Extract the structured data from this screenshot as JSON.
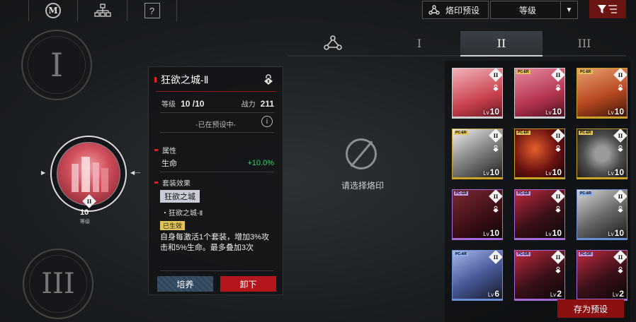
{
  "top_nav": {
    "help": "?"
  },
  "toolbar": {
    "preset_label": "烙印预设",
    "sort_value": "等级",
    "save_label": "存为预设"
  },
  "slots": {
    "slot1_numeral": "I",
    "slot3_numeral": "III",
    "selected_level": "10",
    "selected_level_label": "等级",
    "selected_rank": "II"
  },
  "detail": {
    "name": "狂欲之城-Ⅱ",
    "level_label": "等级",
    "level_value": "10 /10",
    "power_label": "战力",
    "power_value": "211",
    "preset_status": "-已在预设中-",
    "attr_header": "属性",
    "attr_name": "生命",
    "attr_value": "+10.0%",
    "set_header": "套装效果",
    "set_name": "狂欲之城",
    "set_piece": "・狂欲之城-Ⅱ",
    "active_tag": "已生效",
    "set_desc": "自身每激活1个套装，增加3%攻击和5%生命。最多叠加3次",
    "upgrade_label": "培养",
    "unequip_label": "卸下"
  },
  "tabs": [
    "I",
    "II",
    "III"
  ],
  "empty_prompt": "请选择烙印",
  "colors": {
    "accent_red": "#8b1111",
    "positive_green": "#3ecf6a",
    "gold_border": "#c9a227",
    "purple_border": "#a66bd6",
    "blue_border": "#6b8fd6"
  },
  "grid": [
    {
      "type": "",
      "rank": "II",
      "level": "10",
      "border": "#cfcfcf",
      "art": "pink-city",
      "locked": true
    },
    {
      "type": "PC-ER",
      "rank": "II",
      "level": "10",
      "border": "#cfcfcf",
      "art": "pink",
      "locked": true
    },
    {
      "type": "PC-ER",
      "rank": "II",
      "level": "10",
      "border": "#c9a227",
      "art": "orange",
      "locked": true
    },
    {
      "type": "PC-ER",
      "rank": "II",
      "level": "10",
      "border": "#c9a227",
      "art": "silver",
      "locked": true
    },
    {
      "type": "PC-ER",
      "rank": "II",
      "level": "10",
      "border": "#c9a227",
      "art": "dark-red",
      "locked": true
    },
    {
      "type": "PC-ER",
      "rank": "II",
      "level": "10",
      "border": "#c9a227",
      "art": "emblem",
      "locked": true
    },
    {
      "type": "PC-GR",
      "rank": "II",
      "level": "10",
      "border": "#a66bd6",
      "art": "figure",
      "locked": true
    },
    {
      "type": "PC-GR",
      "rank": "II",
      "level": "10",
      "border": "#a66bd6",
      "art": "claw",
      "locked": true
    },
    {
      "type": "PC-AR",
      "rank": "II",
      "level": "10",
      "border": "#6b8fd6",
      "art": "mono",
      "locked": true
    },
    {
      "type": "PC-AR",
      "rank": "II",
      "level": "6",
      "border": "#6b8fd6",
      "art": "blue",
      "locked": false
    },
    {
      "type": "PC-GR",
      "rank": "II",
      "level": "2",
      "border": "#a66bd6",
      "art": "claw",
      "locked": true
    },
    {
      "type": "PC-GR",
      "rank": "II",
      "level": "2",
      "border": "#a66bd6",
      "art": "claw",
      "locked": true
    }
  ]
}
